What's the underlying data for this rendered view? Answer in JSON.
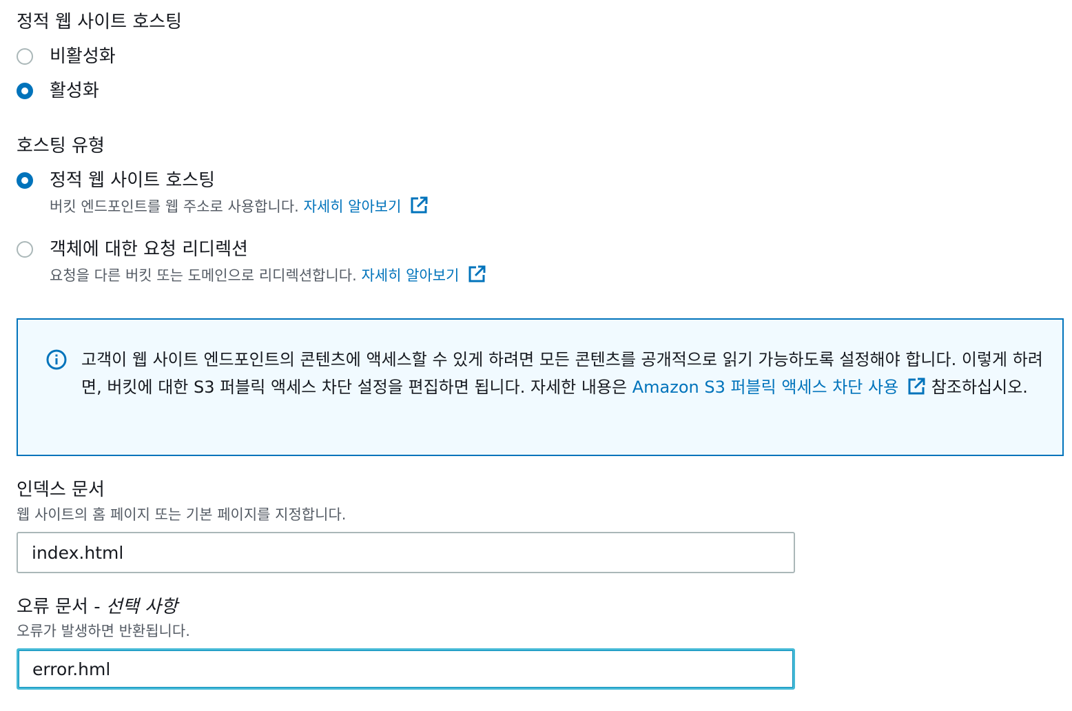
{
  "hosting": {
    "title": "정적 웹 사이트 호스팅",
    "options": [
      {
        "label": "비활성화",
        "checked": false
      },
      {
        "label": "활성화",
        "checked": true
      }
    ]
  },
  "hosting_type": {
    "title": "호스팅 유형",
    "options": [
      {
        "label": "정적 웹 사이트 호스팅",
        "checked": true,
        "description": "버킷 엔드포인트를 웹 주소로 사용합니다.",
        "link": "자세히 알아보기",
        "link_icon": "external-link-icon"
      },
      {
        "label": "객체에 대한 요청 리디렉션",
        "checked": false,
        "description": "요청을 다른 버킷 또는 도메인으로 리디렉션합니다.",
        "link": "자세히 알아보기",
        "link_icon": "external-link-icon"
      }
    ]
  },
  "info_alert": {
    "icon": "info-icon",
    "text_part1": "고객이 웹 사이트 엔드포인트의 콘텐츠에 액세스할 수 있게 하려면 모든 콘텐츠를 공개적으로 읽기 가능하도록 설정해야 합니다. 이렇게 하려면, 버킷에 대한 S3 퍼블릭 액세스 차단 설정을 편집하면 됩니다. 자세한 내용은 ",
    "link": "Amazon S3 퍼블릭 액세스 차단 사용",
    "text_part2": " 참조하십시오."
  },
  "index_document": {
    "label": "인덱스 문서",
    "description": "웹 사이트의 홈 페이지 또는 기본 페이지를 지정합니다.",
    "value": "index.html"
  },
  "error_document": {
    "label": "오류 문서 - ",
    "label_optional": "선택 사항",
    "description": "오류가 발생하면 반환됩니다.",
    "value": "error.hml"
  },
  "colors": {
    "accent": "#0073bb",
    "info_bg": "#f1faff",
    "focus": "#44b9d6",
    "text": "#16191f",
    "secondary_text": "#545b64"
  }
}
